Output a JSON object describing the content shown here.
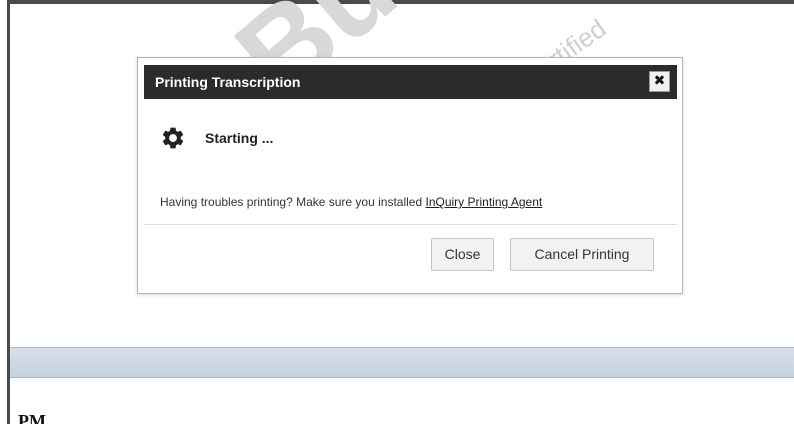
{
  "watermark": {
    "main_text": "Built",
    "sub_text": "Certified"
  },
  "dialog": {
    "title": "Printing Transcription",
    "close_glyph": "✖",
    "status_icon": "gear-icon",
    "status_text": "Starting ...",
    "help_prefix": "Having troubles printing? Make sure you installed ",
    "help_link": "InQuiry Printing Agent",
    "buttons": {
      "close": "Close",
      "cancel": "Cancel Printing"
    }
  },
  "background": {
    "partial_text": "PM"
  }
}
